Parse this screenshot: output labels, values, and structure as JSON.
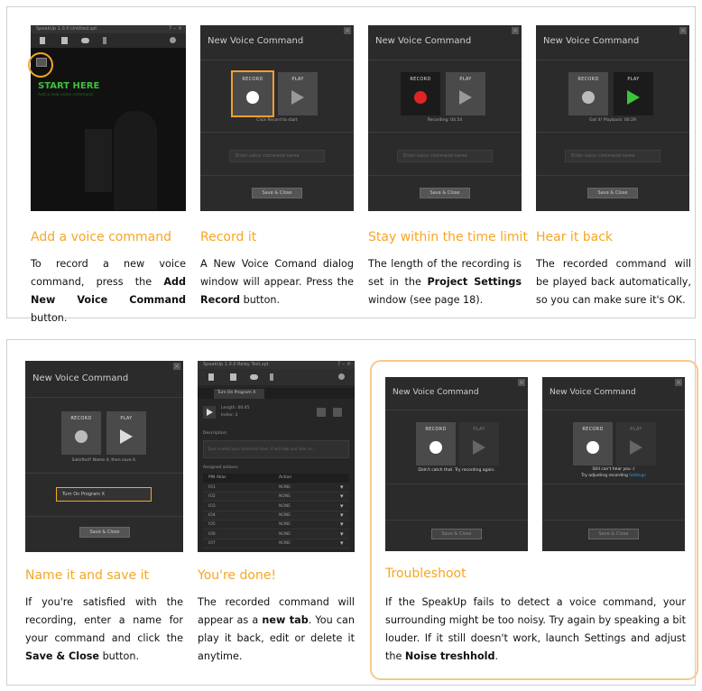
{
  "top_panel": {
    "steps": [
      {
        "heading": "Add a voice command",
        "text_parts": [
          "To record a new voice command, press the ",
          "Add New Voice Command",
          " button."
        ],
        "screenshot": {
          "window_title": "SpeakUp 1.0.0 Untitled.spt",
          "start_label": "START HERE",
          "start_sublabel": "Add a new voice command",
          "window_controls": "? – ×",
          "toolbar_icons": [
            "new-file-icon",
            "save-icon",
            "cloud-icon",
            "upload-icon",
            "gear-icon"
          ],
          "add_button_icon": "add-command-icon"
        }
      },
      {
        "heading": "Record it",
        "text_parts": [
          "A New Voice Comand dialog window will appear. Press the ",
          "Record",
          " button."
        ],
        "screenshot": {
          "dialog_title": "New Voice Command",
          "record_label": "RECORD",
          "play_label": "PLAY",
          "status": "Click Record to start",
          "name_placeholder": "Enter voice command name",
          "save_label": "Save & Close"
        }
      },
      {
        "heading": "Stay within the time limit",
        "text_parts": [
          "The length of the recording is set in the ",
          "Project Settings",
          " window (see page 18)."
        ],
        "screenshot": {
          "dialog_title": "New Voice Command",
          "record_label": "RECORD",
          "play_label": "PLAY",
          "status": "Recording: 04.54",
          "name_placeholder": "Enter voice command name",
          "save_label": "Save & Close"
        }
      },
      {
        "heading": "Hear it back",
        "text_parts": [
          "The recorded command will be played back automatically, so you can make sure it's OK."
        ],
        "screenshot": {
          "dialog_title": "New Voice Command",
          "record_label": "RECORD",
          "play_label": "PLAY",
          "status": "Got it! Playback: 00:29",
          "name_placeholder": "Enter voice command name",
          "save_label": "Save & Close"
        }
      }
    ]
  },
  "bottom_panel": {
    "steps": [
      {
        "heading": "Name it and save it",
        "text_parts": [
          "If you're satisfied with the recording, enter a name for your command and click the ",
          "Save & Close",
          " button."
        ],
        "screenshot": {
          "dialog_title": "New Voice Command",
          "record_label": "RECORD",
          "play_label": "PLAY",
          "status": "Satisfied? Name it, then save it.",
          "name_value": "Turn On Program X",
          "save_label": "Save & Close"
        }
      },
      {
        "heading": "You're done!",
        "text_parts": [
          "The recorded command will appear as a ",
          "new tab",
          ". You can play it back, edit or delete it anytime."
        ],
        "screenshot": {
          "window_title": "SpeakUp 1.0.0 Relay Test.spt",
          "window_controls": "? – ×",
          "tab_label": "Turn On Program X",
          "length_label": "Length: 00:45",
          "index_label": "Index: 3",
          "description_label": "Description:",
          "description_placeholder": "Type in what your command does. It will help you later on...",
          "assigned_label": "Assigned actions:",
          "col_pin": "PIN Alias",
          "col_action": "Action",
          "rows": [
            {
              "pin": "IO1",
              "action": "NONE"
            },
            {
              "pin": "IO2",
              "action": "NONE"
            },
            {
              "pin": "IO3",
              "action": "NONE"
            },
            {
              "pin": "IO4",
              "action": "NONE"
            },
            {
              "pin": "IO5",
              "action": "NONE"
            },
            {
              "pin": "IO6",
              "action": "NONE"
            },
            {
              "pin": "IO7",
              "action": "NONE"
            }
          ]
        }
      }
    ],
    "troubleshoot": {
      "heading": "Troubleshoot",
      "text_parts": [
        "If the SpeakUp fails to detect a voice command, your surrounding might be too noisy. Try again by speaking a bit louder. If it still doesn't work, launch Settings and adjust the ",
        "Noise treshhold",
        "."
      ],
      "screens": [
        {
          "dialog_title": "New Voice Command",
          "record_label": "RECORD",
          "play_label": "PLAY",
          "status": "Didn't catch that. Try recording again.",
          "save_label": "Save & Close"
        },
        {
          "dialog_title": "New Voice Command",
          "record_label": "RECORD",
          "play_label": "PLAY",
          "status": "Still can't hear you :(",
          "status2_prefix": "Try adjusting recording ",
          "status2_link": "Settings",
          "save_label": "Save & Close"
        }
      ]
    }
  },
  "colors": {
    "accent": "#f5a623",
    "record_red": "#e02424",
    "play_green": "#3cc43c",
    "start_green": "#3fbf3f",
    "link_blue": "#2a9df4"
  }
}
